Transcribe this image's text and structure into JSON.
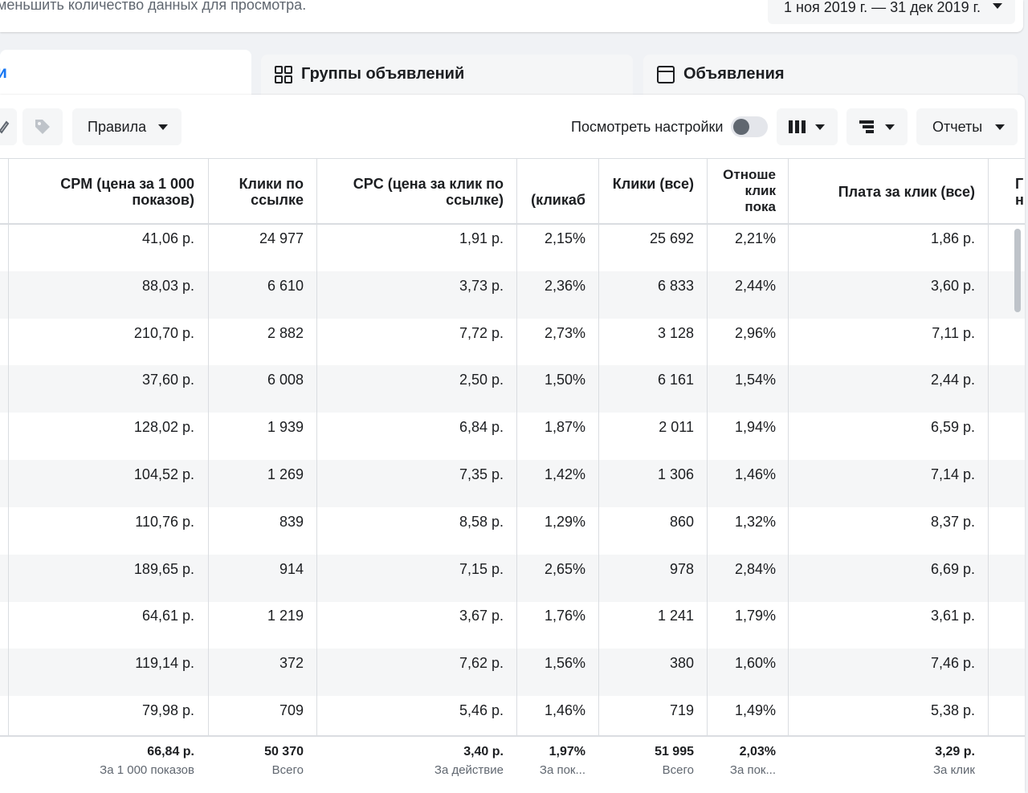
{
  "topbar": {
    "hint": "меньшить количество данных для просмотра.",
    "date_range": "1 ноя 2019 г. — 31 дек 2019 г."
  },
  "tabs": {
    "campaigns_partial": "и",
    "ad_sets": "Группы объявлений",
    "ads": "Объявления"
  },
  "toolbar": {
    "rules": "Правила",
    "view_settings": "Посмотреть настройки",
    "reports": "Отчеты"
  },
  "table": {
    "headers": [
      "CPM (цена за 1 000 показов)",
      "Клики по ссылке",
      "CPC (цена за клик по ссылке)",
      "(кликаб",
      "Клики (все)",
      "Отноше клик пока",
      "Плата за клик (все)",
      "Г н"
    ],
    "rows": [
      [
        "41,06 р.",
        "24 977",
        "1,91 р.",
        "2,15%",
        "25 692",
        "2,21%",
        "1,86 р."
      ],
      [
        "88,03 р.",
        "6 610",
        "3,73 р.",
        "2,36%",
        "6 833",
        "2,44%",
        "3,60 р."
      ],
      [
        "210,70 р.",
        "2 882",
        "7,72 р.",
        "2,73%",
        "3 128",
        "2,96%",
        "7,11 р."
      ],
      [
        "37,60 р.",
        "6 008",
        "2,50 р.",
        "1,50%",
        "6 161",
        "1,54%",
        "2,44 р."
      ],
      [
        "128,02 р.",
        "1 939",
        "6,84 р.",
        "1,87%",
        "2 011",
        "1,94%",
        "6,59 р."
      ],
      [
        "104,52 р.",
        "1 269",
        "7,35 р.",
        "1,42%",
        "1 306",
        "1,46%",
        "7,14 р."
      ],
      [
        "110,76 р.",
        "839",
        "8,58 р.",
        "1,29%",
        "860",
        "1,32%",
        "8,37 р."
      ],
      [
        "189,65 р.",
        "914",
        "7,15 р.",
        "2,65%",
        "978",
        "2,84%",
        "6,69 р."
      ],
      [
        "64,61 р.",
        "1 219",
        "3,67 р.",
        "1,76%",
        "1 241",
        "1,79%",
        "3,61 р."
      ],
      [
        "119,14 р.",
        "372",
        "7,62 р.",
        "1,56%",
        "380",
        "1,60%",
        "7,46 р."
      ],
      [
        "79,98 р.",
        "709",
        "5,46 р.",
        "1,46%",
        "719",
        "1,49%",
        "5,38 р."
      ]
    ],
    "totals": [
      {
        "value": "66,84 р.",
        "sub": "За 1 000 показов"
      },
      {
        "value": "50 370",
        "sub": "Всего"
      },
      {
        "value": "3,40 р.",
        "sub": "За действие"
      },
      {
        "value": "1,97%",
        "sub": "За пок..."
      },
      {
        "value": "51 995",
        "sub": "Всего"
      },
      {
        "value": "2,03%",
        "sub": "За пок..."
      },
      {
        "value": "3,29 р.",
        "sub": "За клик"
      }
    ]
  }
}
